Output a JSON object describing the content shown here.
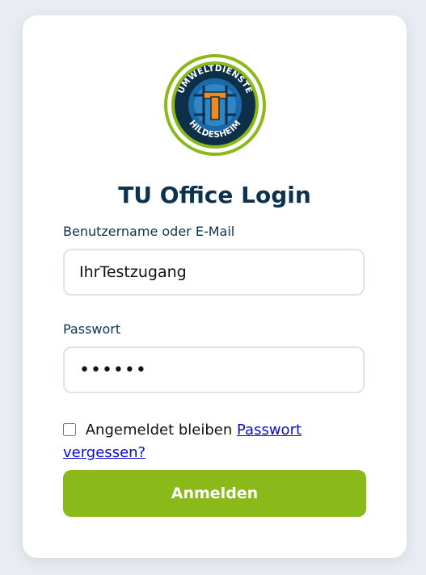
{
  "login": {
    "title": "TU Office Login",
    "logo": {
      "top_text": "UMWELTDIENSTE",
      "bottom_text": "HILDESHEIM",
      "center_letter": "T"
    },
    "username_label": "Benutzername oder E-Mail",
    "username_value": "IhrTestzugang",
    "password_label": "Passwort",
    "password_value": "••••••",
    "remember_label": "Angemeldet bleiben",
    "forgot_link": "Passwort vergessen?",
    "submit_label": "Anmelden"
  },
  "colors": {
    "background": "#e9edf3",
    "card": "#ffffff",
    "title": "#0b3350",
    "button": "#8aba19",
    "link": "#0b0bcc",
    "logo_ring": "#8aba19",
    "logo_blue": "#1a6aa8",
    "logo_orange": "#f08a1c"
  }
}
